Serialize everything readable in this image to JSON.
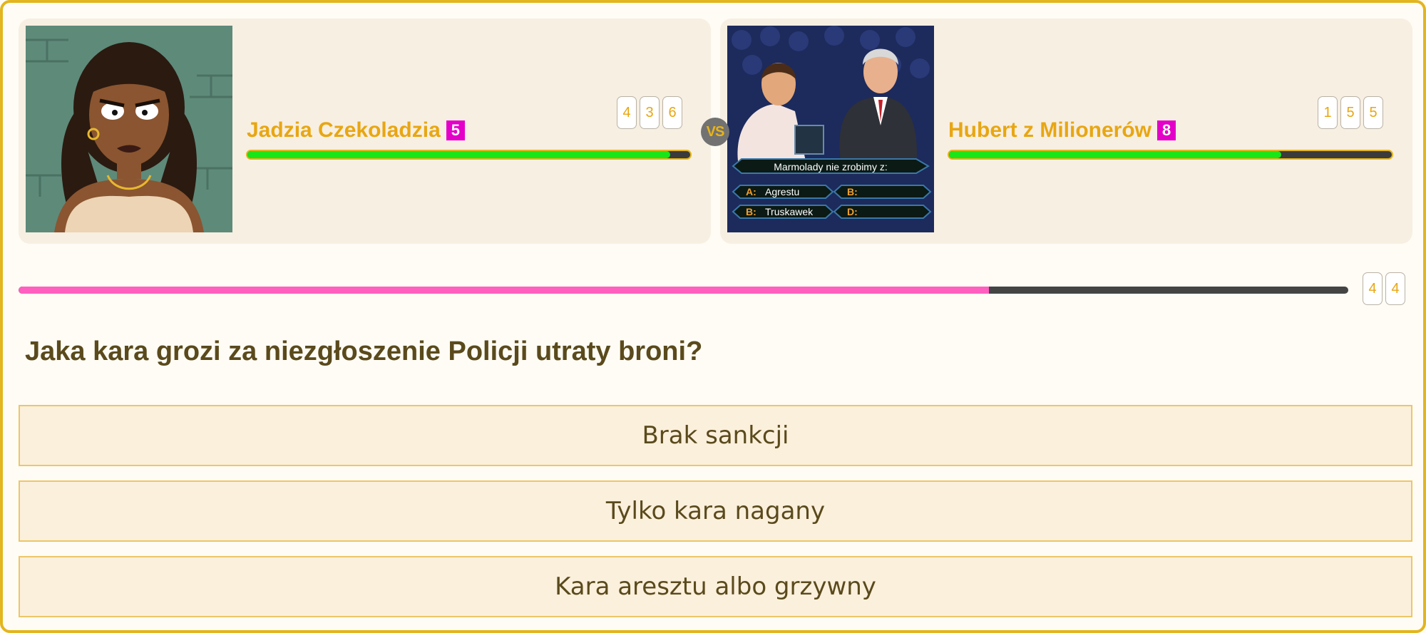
{
  "players": [
    {
      "name": "Jadzia Czekoladzia",
      "level": "5",
      "score_digits": [
        "4",
        "3",
        "6"
      ],
      "health": 0.955,
      "avatar_icon": "woman-portrait-icon"
    },
    {
      "name": "Hubert z Milionerów",
      "level": "8",
      "score_digits": [
        "1",
        "5",
        "5"
      ],
      "health": 0.75,
      "avatar_icon": "quiz-show-host-icon",
      "avatar_text": {
        "question": "Marmolady nie zrobimy z:",
        "a_key": "A:",
        "a_text": "Agrestu",
        "b_key": "B:",
        "c_key": "B:",
        "c_text": "Truskawek",
        "d_key": "D:"
      }
    }
  ],
  "vs_label": "VS",
  "timer": {
    "progress": 0.73,
    "digits": [
      "4",
      "4"
    ]
  },
  "question": "Jaka kara grozi za niezgłoszenie Policji utraty broni?",
  "answers": [
    "Brak sankcji",
    "Tylko kara nagany",
    "Kara aresztu albo grzywny"
  ],
  "colors": {
    "accent_gold": "#e8a612",
    "level_badge": "#e400c8",
    "health_green": "#19e619",
    "timer_pink": "#ff5fbf",
    "text_brown": "#5a4a1c"
  }
}
